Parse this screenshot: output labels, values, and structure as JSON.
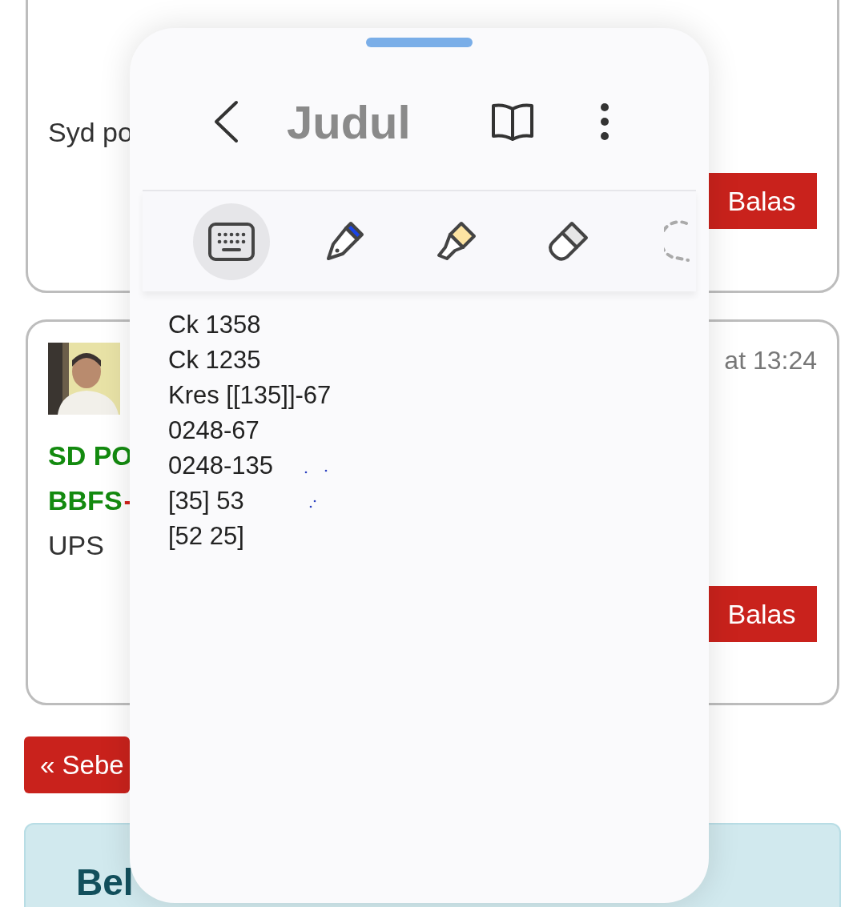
{
  "comments": [
    {
      "body": "Syd po",
      "reply": "Balas"
    },
    {
      "timestamp": "at 13:24",
      "lines": [
        {
          "kind": "title",
          "text": "SD PO"
        },
        {
          "kind": "title",
          "text": "BBFS",
          "suffix": "-"
        },
        {
          "kind": "plain",
          "text": "UPS"
        }
      ],
      "reply": "Balas"
    }
  ],
  "pagination": {
    "prev_button": "« Sebe"
  },
  "info_box": {
    "title": "Bel"
  },
  "note_window": {
    "title": "Judul",
    "tools": [
      {
        "kind": "keyboard",
        "selected": true
      },
      {
        "kind": "pen",
        "selected": false
      },
      {
        "kind": "highlighter",
        "selected": false
      },
      {
        "kind": "eraser",
        "selected": false
      },
      {
        "kind": "lasso",
        "selected": false
      }
    ],
    "lines": [
      "Ck 1358",
      "Ck 1235",
      "Kres [[135]]-67",
      "0248-67",
      "0248-135",
      "[35] 53",
      "[52 25]"
    ]
  }
}
